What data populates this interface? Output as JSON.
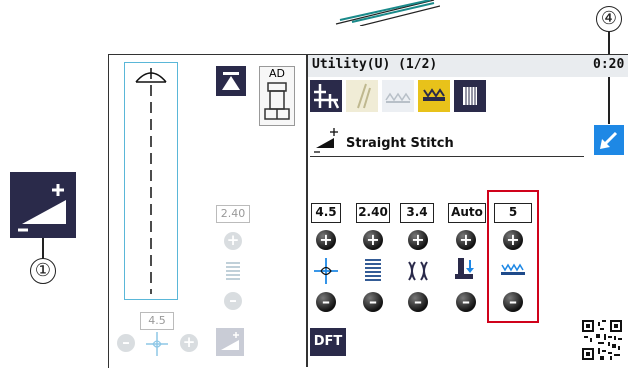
{
  "callouts": {
    "one": "①",
    "four": "④"
  },
  "screen": {
    "pattern_title": "Utility(U) (1/2)",
    "time": "0:20",
    "stitch_name": "Straight Stitch",
    "presser_foot_code": "AD",
    "left_width_value": "2.40",
    "left_position_value": "4.5",
    "dft_label": "DFT"
  },
  "settings": {
    "values": [
      "4.5",
      "2.40",
      "3.4",
      "Auto",
      "5"
    ],
    "plus_symbol": "+",
    "minus_symbol": "–"
  },
  "colors": {
    "navy": "#2a2a4a",
    "accent_blue": "#1e88e5",
    "highlight_red": "#d0021b",
    "selected_tab": "#e8c21a"
  }
}
